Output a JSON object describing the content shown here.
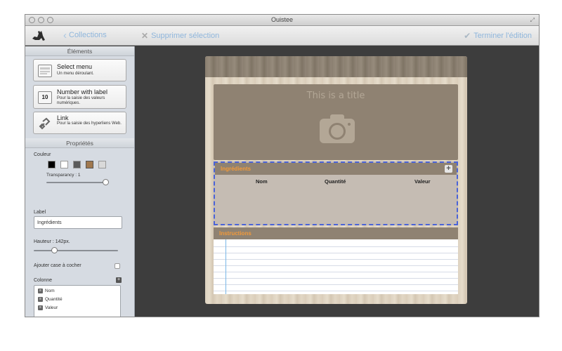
{
  "window": {
    "title": "Ouistee"
  },
  "toolbar": {
    "back_label": "Collections",
    "delete_label": "Supprimer sélection",
    "finish_label": "Terminer l'édition",
    "accent_color": "#8fb6dc"
  },
  "sidebar": {
    "elements_header": "Éléments",
    "elements": [
      {
        "title": "Select menu",
        "description": "Un menu déroulant.",
        "icon": "select-menu-icon"
      },
      {
        "title": "Number with label",
        "description": "Pour la saisie des valeurs numériques.",
        "icon": "number-stepper-icon",
        "icon_text": "10"
      },
      {
        "title": "Link",
        "description": "Pour la saisie des hyperliens Web.",
        "icon": "link-icon"
      }
    ],
    "properties_header": "Propriétés",
    "color_label": "Couleur",
    "colors": [
      "#000000",
      "#ffffff",
      "#5b5b5b",
      "#a0784e",
      "#d9d9d9"
    ],
    "transparency_label": "Transparancy : 1",
    "transparency_value": 1,
    "label_caption": "Label",
    "label_value": "Ingrédients",
    "height_label": "Hauteur : 142px.",
    "height_value": 142,
    "checkbox_label": "Ajouter case à cocher",
    "checkbox_checked": false,
    "columns_label": "Colonne",
    "columns": [
      "Nom",
      "Quantité",
      "Valeur"
    ]
  },
  "document": {
    "title": "This is a title",
    "ingredients": {
      "title": "Ingrédients",
      "columns": [
        "Nom",
        "Quantité",
        "Valeur"
      ]
    },
    "instructions": {
      "title": "Instructions"
    },
    "selection_color": "#4a63d8",
    "label_color": "#f29a3a"
  }
}
